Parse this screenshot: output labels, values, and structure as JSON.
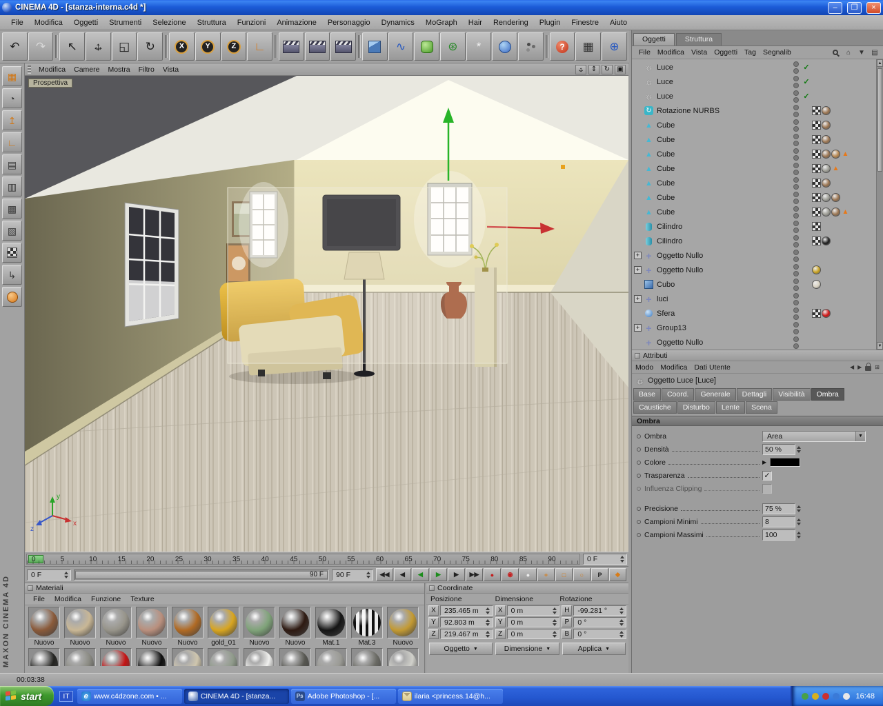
{
  "titlebar": {
    "title": "CINEMA 4D - [stanza-interna.c4d *]",
    "minimize": "–",
    "maximize": "❐",
    "close": "×"
  },
  "menubar": {
    "items": [
      "File",
      "Modifica",
      "Oggetti",
      "Strumenti",
      "Selezione",
      "Struttura",
      "Funzioni",
      "Animazione",
      "Personaggio",
      "Dynamics",
      "MoGraph",
      "Hair",
      "Rendering",
      "Plugin",
      "Finestre",
      "Aiuto"
    ]
  },
  "toolbar": {
    "icons": [
      {
        "name": "undo-button",
        "g": "↶",
        "c": "#1e1e1e"
      },
      {
        "name": "redo-button",
        "g": "↷",
        "c": "#d8d8d8"
      },
      {
        "name": "separator",
        "kind": "sep",
        "g": ""
      },
      {
        "name": "live-selection-button",
        "g": "↖",
        "c": "#1e1e1e"
      },
      {
        "name": "move-button",
        "kind": "move",
        "g": "",
        "c": "#1e1e1e"
      },
      {
        "name": "scale-button",
        "g": "◱",
        "c": "#1e1e1e"
      },
      {
        "name": "rotate-button",
        "g": "↻",
        "c": "#1e1e1e"
      },
      {
        "name": "separator",
        "kind": "sep",
        "g": ""
      },
      {
        "name": "lock-x-button",
        "kind": "axis",
        "g": "X"
      },
      {
        "name": "lock-y-button",
        "kind": "axis",
        "g": "Y"
      },
      {
        "name": "lock-z-button",
        "kind": "axis",
        "g": "Z"
      },
      {
        "name": "coordinate-system-button",
        "g": "∟",
        "c": "#d87818"
      },
      {
        "name": "separator",
        "kind": "sep",
        "g": ""
      },
      {
        "name": "render-view-button",
        "kind": "clapper",
        "g": ""
      },
      {
        "name": "render-region-button",
        "kind": "clapper",
        "g": ""
      },
      {
        "name": "render-settings-button",
        "kind": "clapper",
        "g": ""
      },
      {
        "name": "separator",
        "kind": "sep",
        "g": ""
      },
      {
        "name": "add-primitive-button",
        "kind": "cube3d",
        "g": ""
      },
      {
        "name": "add-spline-button",
        "g": "∿",
        "c": "#2a5ac0"
      },
      {
        "name": "add-nurbs-button",
        "kind": "nurbs",
        "g": ""
      },
      {
        "name": "add-modeling-button",
        "g": "⊛",
        "c": "#2a8a2a"
      },
      {
        "name": "add-particles-button",
        "g": "*",
        "c": "#f0f0f0"
      },
      {
        "name": "add-deformer-button",
        "kind": "deform",
        "g": ""
      },
      {
        "name": "add-environment-button",
        "kind": "dots",
        "g": ""
      },
      {
        "name": "separator",
        "kind": "sep",
        "g": ""
      },
      {
        "name": "help-button",
        "kind": "help",
        "g": "?"
      },
      {
        "name": "layout-grid-button",
        "g": "▦",
        "c": "#333333"
      },
      {
        "name": "globe-button",
        "g": "⊕",
        "c": "#2a5ac0"
      }
    ]
  },
  "left_toolbar": {
    "icons": [
      {
        "name": "layout-window-icon",
        "g": "▦",
        "c": "#d07818"
      },
      {
        "name": "model-mode-icon",
        "g": "◔",
        "c": "#333333"
      },
      {
        "name": "axis-mode-icon",
        "g": "↥",
        "c": "#d07818"
      },
      {
        "name": "coord-mode-icon",
        "g": "∟",
        "c": "#d07818"
      },
      {
        "name": "points-mode-icon",
        "g": "▤",
        "c": "#3a3a3a"
      },
      {
        "name": "edges-mode-icon",
        "g": "▥",
        "c": "#3a3a3a"
      },
      {
        "name": "polygons-mode-icon",
        "g": "▩",
        "c": "#3a3a3a"
      },
      {
        "name": "object-mode-icon",
        "g": "▧",
        "c": "#3a3a3a"
      },
      {
        "name": "texture-mode-icon",
        "kind": "checker",
        "g": ""
      },
      {
        "name": "workplane-mode-icon",
        "g": "↳",
        "c": "#3a3a3a"
      },
      {
        "name": "animation-mode-icon",
        "kind": "ball",
        "g": ""
      }
    ]
  },
  "branding": "MAXON  CINEMA 4D",
  "viewport": {
    "menu": [
      "Modifica",
      "Camere",
      "Mostra",
      "Filtro",
      "Vista"
    ],
    "icons": [
      {
        "name": "pan-view-icon",
        "kind": "move",
        "g": ""
      },
      {
        "name": "zoom-view-icon",
        "g": "⇕"
      },
      {
        "name": "rotate-view-icon",
        "g": "↻"
      },
      {
        "name": "maximize-view-icon",
        "g": "▣"
      }
    ],
    "camera_label": "Prospettiva",
    "gizmo": {
      "x": "x",
      "y": "y",
      "z": "z"
    }
  },
  "timeline": {
    "ticks": [
      "0",
      "5",
      "10",
      "15",
      "20",
      "25",
      "30",
      "35",
      "40",
      "45",
      "50",
      "55",
      "60",
      "65",
      "70",
      "75",
      "80",
      "85",
      "90"
    ],
    "current_frame": "0 F",
    "range_start": "0 F",
    "range_handle_label": "90 F",
    "range_end": "90 F",
    "buttons": [
      {
        "name": "goto-start-button",
        "g": "◀◀"
      },
      {
        "name": "prev-key-button",
        "g": "◀"
      },
      {
        "name": "prev-frame-button",
        "g": "◀",
        "c": "#1c8c1c"
      },
      {
        "name": "play-button",
        "g": "▶",
        "c": "#1c8c1c"
      },
      {
        "name": "next-frame-button",
        "g": "▶"
      },
      {
        "name": "goto-end-button",
        "g": "▶▶"
      },
      {
        "name": "record-keyframe-button",
        "g": "●",
        "c": "#c41e1e"
      },
      {
        "name": "autokey-button",
        "g": "◉",
        "c": "#c41e1e"
      },
      {
        "name": "record-filter-button",
        "g": "●",
        "c": "#ededed"
      },
      {
        "name": "record-position-button",
        "g": "+",
        "c": "#d87c18"
      },
      {
        "name": "record-scale-button",
        "g": "□",
        "c": "#d87c18"
      },
      {
        "name": "record-rotation-button",
        "g": "○",
        "c": "#d87c18"
      },
      {
        "name": "record-parameter-button",
        "g": "P",
        "c": "#222222"
      },
      {
        "name": "record-pla-button",
        "g": "◆",
        "c": "#d87c18"
      }
    ]
  },
  "materials": {
    "title": "Materiali",
    "menu": [
      "File",
      "Modifica",
      "Funzione",
      "Texture"
    ],
    "items": [
      {
        "name": "Nuovo",
        "color": "#8a5a3a"
      },
      {
        "name": "Nuovo",
        "color": "#c9b795"
      },
      {
        "name": "Nuovo",
        "color": "#97948a"
      },
      {
        "name": "Nuovo",
        "color": "#b98f7d"
      },
      {
        "name": "Nuovo",
        "color": "#b06a24"
      },
      {
        "name": "gold_01",
        "color": "#d8a520"
      },
      {
        "name": "Nuovo",
        "color": "#7fa379"
      },
      {
        "name": "Nuovo",
        "color": "#2e1a12"
      },
      {
        "name": "Mat.1",
        "color": "#151515"
      },
      {
        "name": "Mat.3",
        "color": "#e8e8e8",
        "style": "stripes"
      },
      {
        "name": "Nuovo",
        "color": "#c39a33"
      }
    ],
    "row2": [
      "#232320",
      "#8a8a82",
      "#c41414",
      "#0f0f0f",
      "#cfc6ae",
      "#8f9a8a",
      "#f0f0ee",
      "#565650",
      "#9a9a94",
      "#6a6a64",
      "#d0d0ca"
    ]
  },
  "coordinates": {
    "title": "Coordinate",
    "columns": [
      "Posizione",
      "Dimensione",
      "Rotazione"
    ],
    "rows": [
      {
        "pl": "X",
        "pv": "235.465 m",
        "dl": "X",
        "dv": "0 m",
        "rl": "H",
        "rv": "-99.281 °"
      },
      {
        "pl": "Y",
        "pv": "92.803 m",
        "dl": "Y",
        "dv": "0 m",
        "rl": "P",
        "rv": "0 °"
      },
      {
        "pl": "Z",
        "pv": "219.467 m",
        "dl": "Z",
        "dv": "0 m",
        "rl": "B",
        "rv": "0 °"
      }
    ],
    "buttons": [
      {
        "label": "Oggetto",
        "drop": true
      },
      {
        "label": "Dimensione",
        "drop": true
      },
      {
        "label": "Applica"
      }
    ]
  },
  "object_manager": {
    "tabs": [
      {
        "label": "Oggetti",
        "active": true
      },
      {
        "label": "Struttura",
        "active": false
      }
    ],
    "menu": [
      "File",
      "Modifica",
      "Vista",
      "Oggetti",
      "Tag",
      "Segnalib"
    ],
    "objects": [
      {
        "name": "Luce",
        "icon": "light",
        "check": "✓",
        "tags": []
      },
      {
        "name": "Luce",
        "icon": "light",
        "check": "✓",
        "tags": []
      },
      {
        "name": "Luce",
        "icon": "light",
        "check": "✓",
        "tags": []
      },
      {
        "name": "Rotazione NURBS",
        "icon": "rot-nurbs",
        "tags": [
          "checker",
          "#9a7450"
        ]
      },
      {
        "name": "Cube",
        "icon": "poly",
        "tags": [
          "checker",
          "#9a7450"
        ]
      },
      {
        "name": "Cube",
        "icon": "poly",
        "tags": [
          "checker",
          "#9a7450"
        ]
      },
      {
        "name": "Cube",
        "icon": "poly",
        "tags": [
          "checker",
          "#9a7450",
          "#b5854e",
          "tri"
        ]
      },
      {
        "name": "Cube",
        "icon": "poly",
        "tags": [
          "checker",
          "#9c9c94",
          "tri"
        ]
      },
      {
        "name": "Cube",
        "icon": "poly",
        "tags": [
          "checker",
          "#9a7450"
        ]
      },
      {
        "name": "Cube",
        "icon": "poly",
        "tags": [
          "checker",
          "#9c9c94",
          "#9a7450"
        ]
      },
      {
        "name": "Cube",
        "icon": "poly",
        "tags": [
          "checker",
          "#9c9c94",
          "#9a7450",
          "tri"
        ]
      },
      {
        "name": "Cilindro",
        "icon": "cylinder",
        "tags": [
          "checker"
        ]
      },
      {
        "name": "Cilindro",
        "icon": "cylinder",
        "tags": [
          "checker",
          "#1a1a1a"
        ]
      },
      {
        "name": "Oggetto Nullo",
        "icon": "null",
        "expand": "+",
        "tags": []
      },
      {
        "name": "Oggetto Nullo",
        "icon": "null",
        "expand": "+",
        "tags": [
          "#c8a11e"
        ]
      },
      {
        "name": "Cubo",
        "icon": "cube",
        "tags": [
          "#d9d2c2"
        ]
      },
      {
        "name": "luci",
        "icon": "null",
        "expand": "+",
        "tags": []
      },
      {
        "name": "Sfera",
        "icon": "sphere",
        "tags": [
          "checker",
          "#d01212"
        ]
      },
      {
        "name": "Group13",
        "icon": "null",
        "expand": "+",
        "tags": []
      },
      {
        "name": "Oggetto Nullo",
        "icon": "null",
        "tags": []
      }
    ]
  },
  "attributes": {
    "panel_title": "Attributi",
    "menu": [
      "Modo",
      "Modifica",
      "Dati Utente"
    ],
    "object_title": "Oggetto Luce [Luce]",
    "tabs_row1": [
      {
        "label": "Base",
        "active": false
      },
      {
        "label": "Coord.",
        "active": false
      },
      {
        "label": "Generale",
        "active": false
      },
      {
        "label": "Dettagli",
        "active": false
      },
      {
        "label": "Visibilità",
        "active": false
      },
      {
        "label": "Ombra",
        "active": true
      }
    ],
    "tabs_row2": [
      {
        "label": "Caustiche",
        "active": false
      },
      {
        "label": "Disturbo",
        "active": false
      },
      {
        "label": "Lente",
        "active": false
      },
      {
        "label": "Scena",
        "active": false
      }
    ],
    "section_title": "Ombra",
    "fields": [
      {
        "label": "Ombra",
        "type": "dropdown",
        "value": "Area"
      },
      {
        "label": "Densità",
        "type": "spin",
        "value": "50 %"
      },
      {
        "label": "Colore",
        "type": "color",
        "value": "#000000"
      },
      {
        "label": "Trasparenza",
        "type": "check",
        "checked": true
      },
      {
        "label": "Influenza Clipping",
        "type": "check",
        "checked": false,
        "disabled": true
      },
      {
        "label": "Precisione",
        "type": "spin",
        "value": "75 %",
        "group2": true
      },
      {
        "label": "Campioni Minimi",
        "type": "spin",
        "value": "8"
      },
      {
        "label": "Campioni Massimi",
        "type": "spin",
        "value": "100"
      }
    ]
  },
  "statusbar": {
    "time": "00:03:38"
  },
  "taskbar": {
    "start_label": "start",
    "language": "IT",
    "windows": [
      {
        "label": "www.c4dzone.com • ...",
        "icon": "ie",
        "active": false
      },
      {
        "label": "CINEMA 4D - [stanza...",
        "icon": "c4d",
        "active": true
      },
      {
        "label": "Adobe Photoshop - [...",
        "icon": "ps",
        "active": false
      },
      {
        "label": "ilaria <princess.14@h...",
        "icon": "mail",
        "active": false
      }
    ],
    "clock": "16:48"
  }
}
